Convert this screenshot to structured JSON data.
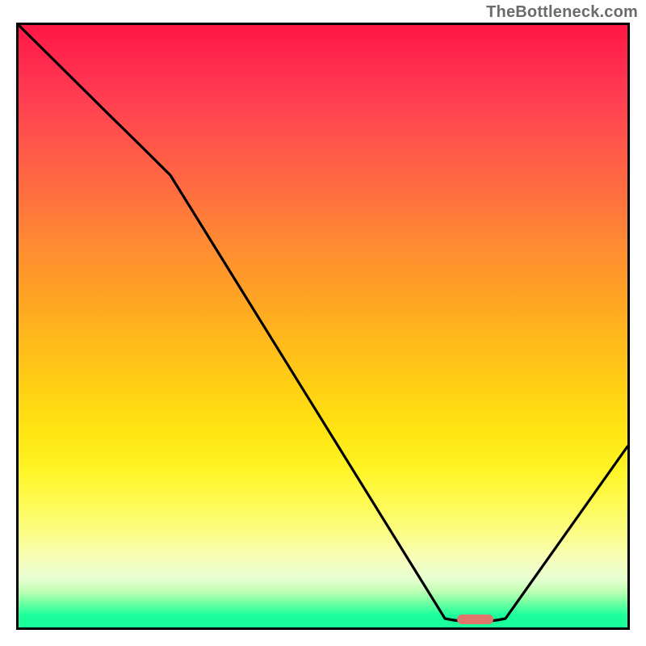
{
  "domain": "Chart",
  "watermark": "TheBottleneck.com",
  "chart_data": {
    "type": "line",
    "title": "",
    "xlabel": "",
    "ylabel": "",
    "xlim": [
      0,
      100
    ],
    "ylim": [
      0,
      100
    ],
    "grid": false,
    "legend": false,
    "series": [
      {
        "name": "bottleneck-curve",
        "color": "#000000",
        "x": [
          0,
          15,
          20,
          25,
          70,
          75,
          80,
          100
        ],
        "y": [
          100,
          85,
          80,
          75,
          1.5,
          0.5,
          1.5,
          30
        ]
      }
    ],
    "marker": {
      "name": "optimal-marker",
      "color": "#e0766b",
      "x_start": 72,
      "x_end": 78,
      "y": 1.2
    },
    "gradient_stops": [
      {
        "pct": 0,
        "color": "#ff1744"
      },
      {
        "pct": 20,
        "color": "#ff5749"
      },
      {
        "pct": 40,
        "color": "#ff9830"
      },
      {
        "pct": 60,
        "color": "#ffd014"
      },
      {
        "pct": 80,
        "color": "#fdfb5a"
      },
      {
        "pct": 92,
        "color": "#e6ffd1"
      },
      {
        "pct": 100,
        "color": "#1aff9c"
      }
    ]
  }
}
